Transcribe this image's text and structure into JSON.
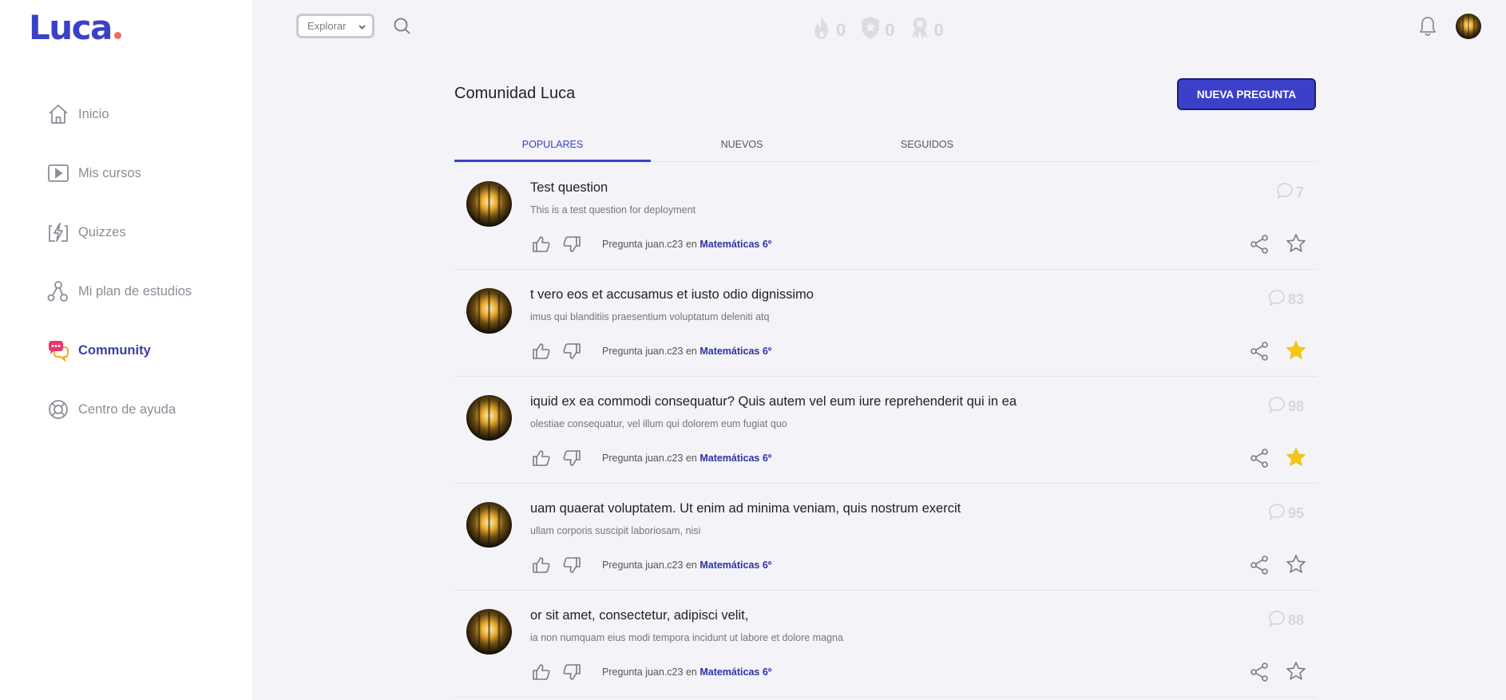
{
  "brand": {
    "name": "Luca",
    "accent": "#3b40c8",
    "dot_color": "#f26d5b"
  },
  "sidebar": {
    "items": [
      {
        "label": "Inicio",
        "icon": "home-icon",
        "active": false
      },
      {
        "label": "Mis cursos",
        "icon": "play-icon",
        "active": false
      },
      {
        "label": "Quizzes",
        "icon": "bolt-icon",
        "active": false
      },
      {
        "label": "Mi plan de estudios",
        "icon": "plan-icon",
        "active": false
      },
      {
        "label": "Community",
        "icon": "chat-icon",
        "active": true
      },
      {
        "label": "Centro de ayuda",
        "icon": "lifebuoy-icon",
        "active": false
      }
    ]
  },
  "topbar": {
    "explore_label": "Explorar",
    "stats": [
      {
        "icon": "flame-icon",
        "value": "0"
      },
      {
        "icon": "shield-icon",
        "value": "0"
      },
      {
        "icon": "badge-icon",
        "value": "0"
      }
    ]
  },
  "main": {
    "title": "Comunidad Luca",
    "new_question_label": "NUEVA PREGUNTA",
    "tabs": [
      {
        "label": "POPULARES",
        "active": true
      },
      {
        "label": "NUEVOS",
        "active": false
      },
      {
        "label": "SEGUIDOS",
        "active": false
      }
    ],
    "questions": [
      {
        "title": "Test question",
        "subtitle": "This is a test question for deployment",
        "author_prefix": "Pregunta juan.c23 en ",
        "course": "Matemáticas 6º",
        "comments": "7",
        "starred": false
      },
      {
        "title": "t vero eos et accusamus et iusto odio dignissimo",
        "subtitle": "imus qui blanditiis praesentium voluptatum deleniti atq",
        "author_prefix": "Pregunta juan.c23 en ",
        "course": "Matemáticas 6º",
        "comments": "83",
        "starred": true
      },
      {
        "title": "iquid ex ea commodi consequatur? Quis autem vel eum iure reprehenderit qui in ea",
        "subtitle": "olestiae consequatur, vel illum qui dolorem eum fugiat quo",
        "author_prefix": "Pregunta juan.c23 en ",
        "course": "Matemáticas 6º",
        "comments": "98",
        "starred": true
      },
      {
        "title": "uam quaerat voluptatem. Ut enim ad minima veniam, quis nostrum exercit",
        "subtitle": "ullam corporis suscipit laboriosam, nisi",
        "author_prefix": "Pregunta juan.c23 en ",
        "course": "Matemáticas 6º",
        "comments": "95",
        "starred": false
      },
      {
        "title": "or sit amet, consectetur, adipisci velit,",
        "subtitle": "ia non numquam eius modi tempora incidunt ut labore et dolore magna",
        "author_prefix": "Pregunta juan.c23 en ",
        "course": "Matemáticas 6º",
        "comments": "88",
        "starred": false
      }
    ]
  },
  "colors": {
    "star_active": "#f5c518",
    "icon_gray": "#8c8c98",
    "active_nav": "#3a3fa8"
  }
}
